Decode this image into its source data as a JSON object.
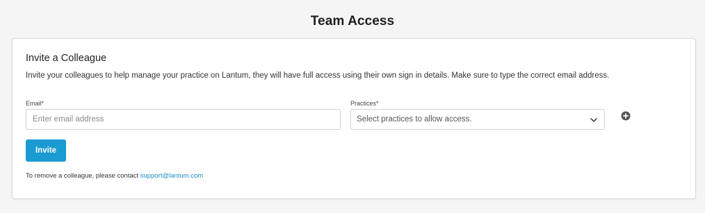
{
  "page": {
    "title": "Team Access"
  },
  "invite": {
    "heading": "Invite a Colleague",
    "description": "Invite your colleagues to help manage your practice on Lantum, they will have full access using their own sign in details. Make sure to type the correct email address.",
    "email_label": "Email*",
    "email_placeholder": "Enter email address",
    "email_value": "",
    "practices_label": "Practices*",
    "practices_placeholder": "Select practices to allow access.",
    "add_icon": "plus-circle-icon",
    "dropdown_icon": "chevron-down-icon",
    "invite_button": "Invite",
    "remove_note": "To remove a colleague, please contact ",
    "support_email": "support@lantum.com"
  },
  "colors": {
    "accent": "#1a9bd1",
    "link": "#1a8fc4",
    "background": "#f5f5f5",
    "icon": "#555555"
  }
}
